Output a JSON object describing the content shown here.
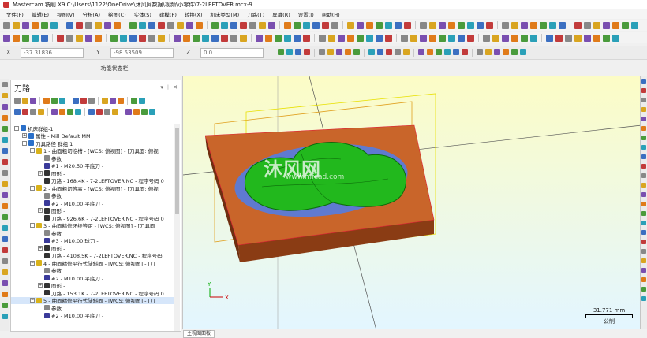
{
  "window": {
    "title": "Mastercam 铣削 X9  C:\\Users\\1122\\OneDrive\\沐风网数据\\视频\\小零件\\7-2LEFTOVER.mcx-9"
  },
  "menu": [
    "文件(F)",
    "编辑(E)",
    "视图(V)",
    "分析(A)",
    "绘图(C)",
    "实体(S)",
    "建模(P)",
    "转换(X)",
    "机床类型(M)",
    "刀路(T)",
    "屏幕(R)",
    "设置(I)",
    "帮助(H)"
  ],
  "coords": {
    "x_label": "X",
    "x_value": "-37.31836",
    "y_label": "Y",
    "y_value": "-98.53509",
    "z_label": "Z",
    "z_value": "0.0"
  },
  "status_title": "功能状态栏",
  "panel": {
    "title": "刀路",
    "tree": [
      {
        "indent": 0,
        "icon": "machine-group-icon",
        "text": "机床群组-1",
        "color": "#2a6fc9",
        "expander": "−"
      },
      {
        "indent": 1,
        "icon": "properties-icon",
        "text": "属性 - Mill Default MM",
        "color": "#2a6fc9",
        "expander": "+"
      },
      {
        "indent": 1,
        "icon": "toolpath-group-icon",
        "text": "刀具路径 群组 1",
        "color": "#2a6fc9",
        "expander": "−"
      },
      {
        "indent": 2,
        "icon": "operation-folder-icon",
        "text": "1 - 曲面粗切挖槽 - [WCS: 俯视图] - [刀具面: 俯视",
        "color": "#d9b21a",
        "expander": "−"
      },
      {
        "indent": 3,
        "icon": "params-icon",
        "text": "参数",
        "color": "#888"
      },
      {
        "indent": 3,
        "icon": "tool-icon",
        "text": "#1 - M20.50 平底刀 -",
        "color": "#3a3a9a"
      },
      {
        "indent": 3,
        "icon": "geometry-icon",
        "text": "图形 -",
        "color": "#333",
        "expander": "+"
      },
      {
        "indent": 3,
        "icon": "toolpath-file-icon",
        "text": "刀路 - 168.4K - 7-2LEFTOVER.NC - 程序号码 0",
        "color": "#333"
      },
      {
        "indent": 2,
        "icon": "operation-folder-icon",
        "text": "2 - 曲面粗切等高 - [WCS: 俯视图] - [刀具面: 俯视",
        "color": "#d9b21a",
        "expander": "−"
      },
      {
        "indent": 3,
        "icon": "params-icon",
        "text": "参数",
        "color": "#888"
      },
      {
        "indent": 3,
        "icon": "tool-icon",
        "text": "#2 - M10.00 平底刀 -",
        "color": "#3a3a9a"
      },
      {
        "indent": 3,
        "icon": "geometry-icon",
        "text": "图形 -",
        "color": "#333",
        "expander": "+"
      },
      {
        "indent": 3,
        "icon": "toolpath-file-icon",
        "text": "刀路 - 926.6K - 7-2LEFTOVER.NC - 程序号码 0",
        "color": "#333"
      },
      {
        "indent": 2,
        "icon": "operation-folder-icon",
        "text": "3 - 曲面精修环绕等距 - [WCS: 俯视图] - [刀具面",
        "color": "#d9b21a",
        "expander": "−"
      },
      {
        "indent": 3,
        "icon": "params-icon",
        "text": "参数",
        "color": "#888"
      },
      {
        "indent": 3,
        "icon": "tool-icon",
        "text": "#3 - M10.00 球刀 -",
        "color": "#3a3a9a"
      },
      {
        "indent": 3,
        "icon": "geometry-icon",
        "text": "图形 -",
        "color": "#333",
        "expander": "+"
      },
      {
        "indent": 3,
        "icon": "toolpath-file-icon",
        "text": "刀路 - 4108.5K - 7-2LEFTOVER.NC - 程序号码",
        "color": "#333"
      },
      {
        "indent": 2,
        "icon": "operation-folder-icon",
        "text": "4 - 曲面精修平行式陡斜面 - [WCS: 俯视图] - [刀",
        "color": "#d9b21a",
        "expander": "−"
      },
      {
        "indent": 3,
        "icon": "params-icon",
        "text": "参数",
        "color": "#888"
      },
      {
        "indent": 3,
        "icon": "tool-icon",
        "text": "#2 - M10.00 平底刀 -",
        "color": "#3a3a9a"
      },
      {
        "indent": 3,
        "icon": "geometry-icon",
        "text": "图形 -",
        "color": "#333",
        "expander": "+"
      },
      {
        "indent": 3,
        "icon": "toolpath-file-icon",
        "text": "刀路 - 153.1K - 7-2LEFTOVER.NC - 程序号码 0",
        "color": "#333"
      },
      {
        "indent": 2,
        "icon": "operation-folder-icon",
        "text": "5 - 曲面精修平行式陡斜面 - [WCS: 俯视图] - [刀",
        "color": "#d9b21a",
        "expander": "−",
        "selected": true
      },
      {
        "indent": 3,
        "icon": "params-icon",
        "text": "参数",
        "color": "#888"
      },
      {
        "indent": 3,
        "icon": "tool-icon",
        "text": "#2 - M10.00 平底刀 -",
        "color": "#3a3a9a"
      }
    ]
  },
  "viewport": {
    "scale_value": "31.771 mm",
    "scale_unit": "公制",
    "tab_label": "主视图面板",
    "watermark": "沐风网",
    "watermark_url": "www.mfcad.com"
  }
}
